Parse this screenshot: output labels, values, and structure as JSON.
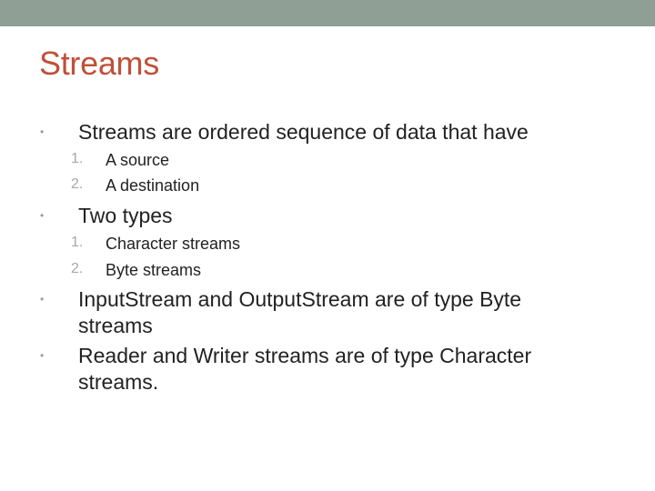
{
  "slide": {
    "title": "Streams",
    "colors": {
      "top_bar": "#8f9f95",
      "title": "#c0503a",
      "body_text": "#222222",
      "bullet": "#9a9a9a"
    },
    "bullets": [
      {
        "marker": "•",
        "text": "Streams are ordered sequence of data that have",
        "sub_items": [
          {
            "number": "1.",
            "text": "A source"
          },
          {
            "number": "2.",
            "text": "A destination"
          }
        ]
      },
      {
        "marker": "•",
        "text": "Two types",
        "sub_items": [
          {
            "number": "1.",
            "text": "Character streams"
          },
          {
            "number": "2.",
            "text": "Byte streams"
          }
        ]
      },
      {
        "marker": "•",
        "text": "InputStream and OutputStream are of type Byte streams"
      },
      {
        "marker": "•",
        "text": "Reader and Writer streams are of type Character streams."
      }
    ]
  }
}
